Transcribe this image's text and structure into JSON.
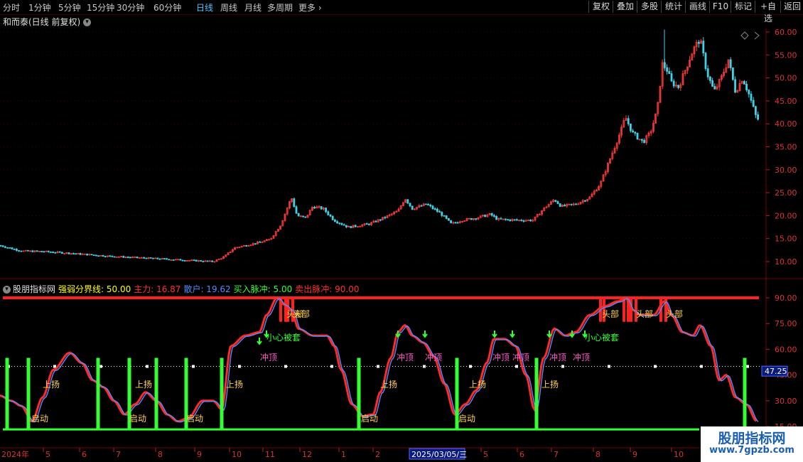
{
  "toolbar": {
    "periods": [
      "分时",
      "1分钟",
      "5分钟",
      "15分钟",
      "30分钟",
      "60分钟",
      "日线",
      "周线",
      "月线",
      "多周期",
      "更多"
    ],
    "active_period": "日线",
    "right_buttons": [
      "复权",
      "叠加",
      "多股",
      "统计",
      "画线",
      "F10",
      "标记",
      "+自选",
      "返回"
    ]
  },
  "price_panel": {
    "title": "和而泰(日线 前复权)",
    "y_ticks": [
      "60.00",
      "55.00",
      "50.00",
      "45.00",
      "40.00",
      "35.00",
      "30.00",
      "25.00",
      "20.00",
      "15.00",
      "10.00"
    ]
  },
  "indicator_panel": {
    "name": "股朋指标网",
    "legend": [
      {
        "label": "强弱分界线: 50.00",
        "color": "#ffff00"
      },
      {
        "label": "主力: 16.87",
        "color": "#ff3030"
      },
      {
        "label": "散户: 19.62",
        "color": "#4f8cff"
      },
      {
        "label": "买入脉冲: 5.00",
        "color": "#33ff33"
      },
      {
        "label": "卖出脉冲: 90.00",
        "color": "#ff3030"
      }
    ],
    "y_ticks": [
      "90.00",
      "75.00",
      "60.00",
      "45.00",
      "30.00",
      "15.00"
    ],
    "current_value": "47.25",
    "annotations": {
      "rise": "上扬",
      "start": "启动",
      "top": "冲顶",
      "careful": "小心被套",
      "peak": "头部"
    }
  },
  "date_axis": {
    "labels": [
      "2024年",
      "5",
      "6",
      "7",
      "8",
      "9",
      "10",
      "11",
      "12",
      "1",
      "2",
      "2025/03/05/三",
      "5",
      "6",
      "7",
      "8",
      "9",
      "10"
    ]
  },
  "watermark": {
    "line1": "股朋指标网",
    "line2": "www.7gpzb.com"
  }
}
